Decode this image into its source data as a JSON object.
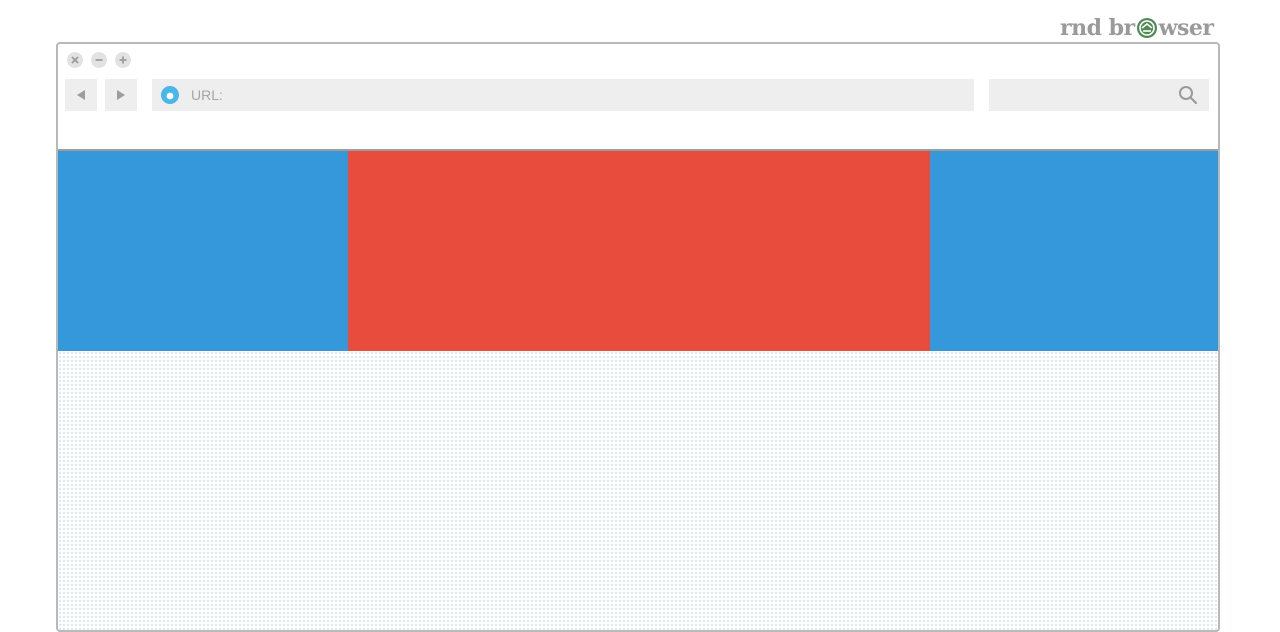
{
  "brand": {
    "text_before": "rnd br",
    "text_after": "wser",
    "color": "#9a9a9a",
    "logo_color": "#4f8a53",
    "logo_icon": "rnd-logo-icon"
  },
  "window_controls": {
    "close_icon": "close-icon",
    "minimize_icon": "minimize-icon",
    "maximize_icon": "maximize-icon"
  },
  "navigation": {
    "back_icon": "back-arrow-icon",
    "forward_icon": "forward-arrow-icon"
  },
  "address_bar": {
    "label": "URL:",
    "value": "",
    "icon": "globe-icon",
    "icon_color": "#4ab7ea"
  },
  "search": {
    "value": "",
    "icon": "search-icon"
  },
  "page": {
    "hero_left_color": "#3498db",
    "hero_center_color": "#e74c3c",
    "hero_right_color": "#3498db",
    "pattern_color": "#c7dfe9"
  }
}
